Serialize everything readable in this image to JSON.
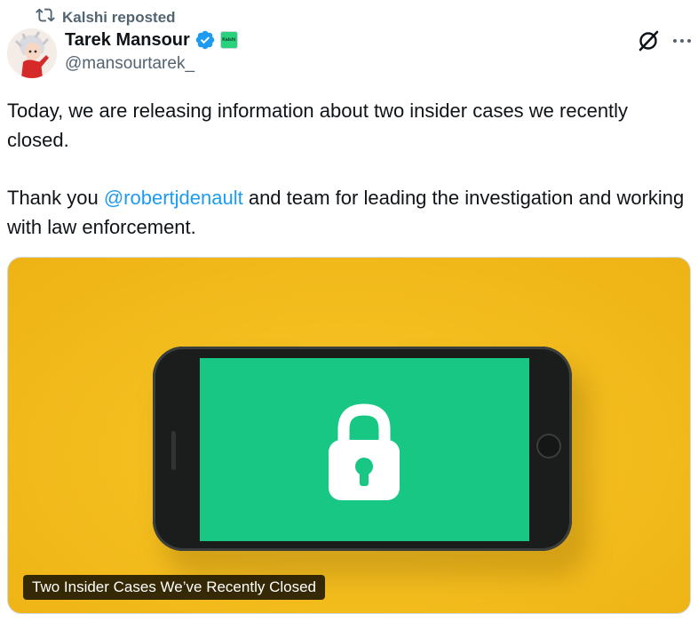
{
  "repost": {
    "text": "Kalshi reposted",
    "icon": "repost-icon"
  },
  "author": {
    "name": "Tarek Mansour",
    "handle": "@mansourtarek_",
    "verified_icon": "verified-badge-icon",
    "affiliate_label": "Kalshi"
  },
  "tweet": {
    "para1": "Today, we are releasing information about two insider cases we recently closed.",
    "para2_prefix": "Thank you ",
    "mention": "@robertjdenault",
    "para2_suffix": " and team for leading the investigation and working with law enforcement."
  },
  "media": {
    "caption": "Two Insider Cases We’ve Recently Closed",
    "icon": "padlock-icon"
  },
  "colors": {
    "text": "#0f1419",
    "secondary": "#536471",
    "link": "#1d9bf0",
    "verified": "#1d9bf0",
    "kalshi_green": "#28d17c",
    "screen_green": "#19c785",
    "background_yellow": "#f3bc1d"
  }
}
